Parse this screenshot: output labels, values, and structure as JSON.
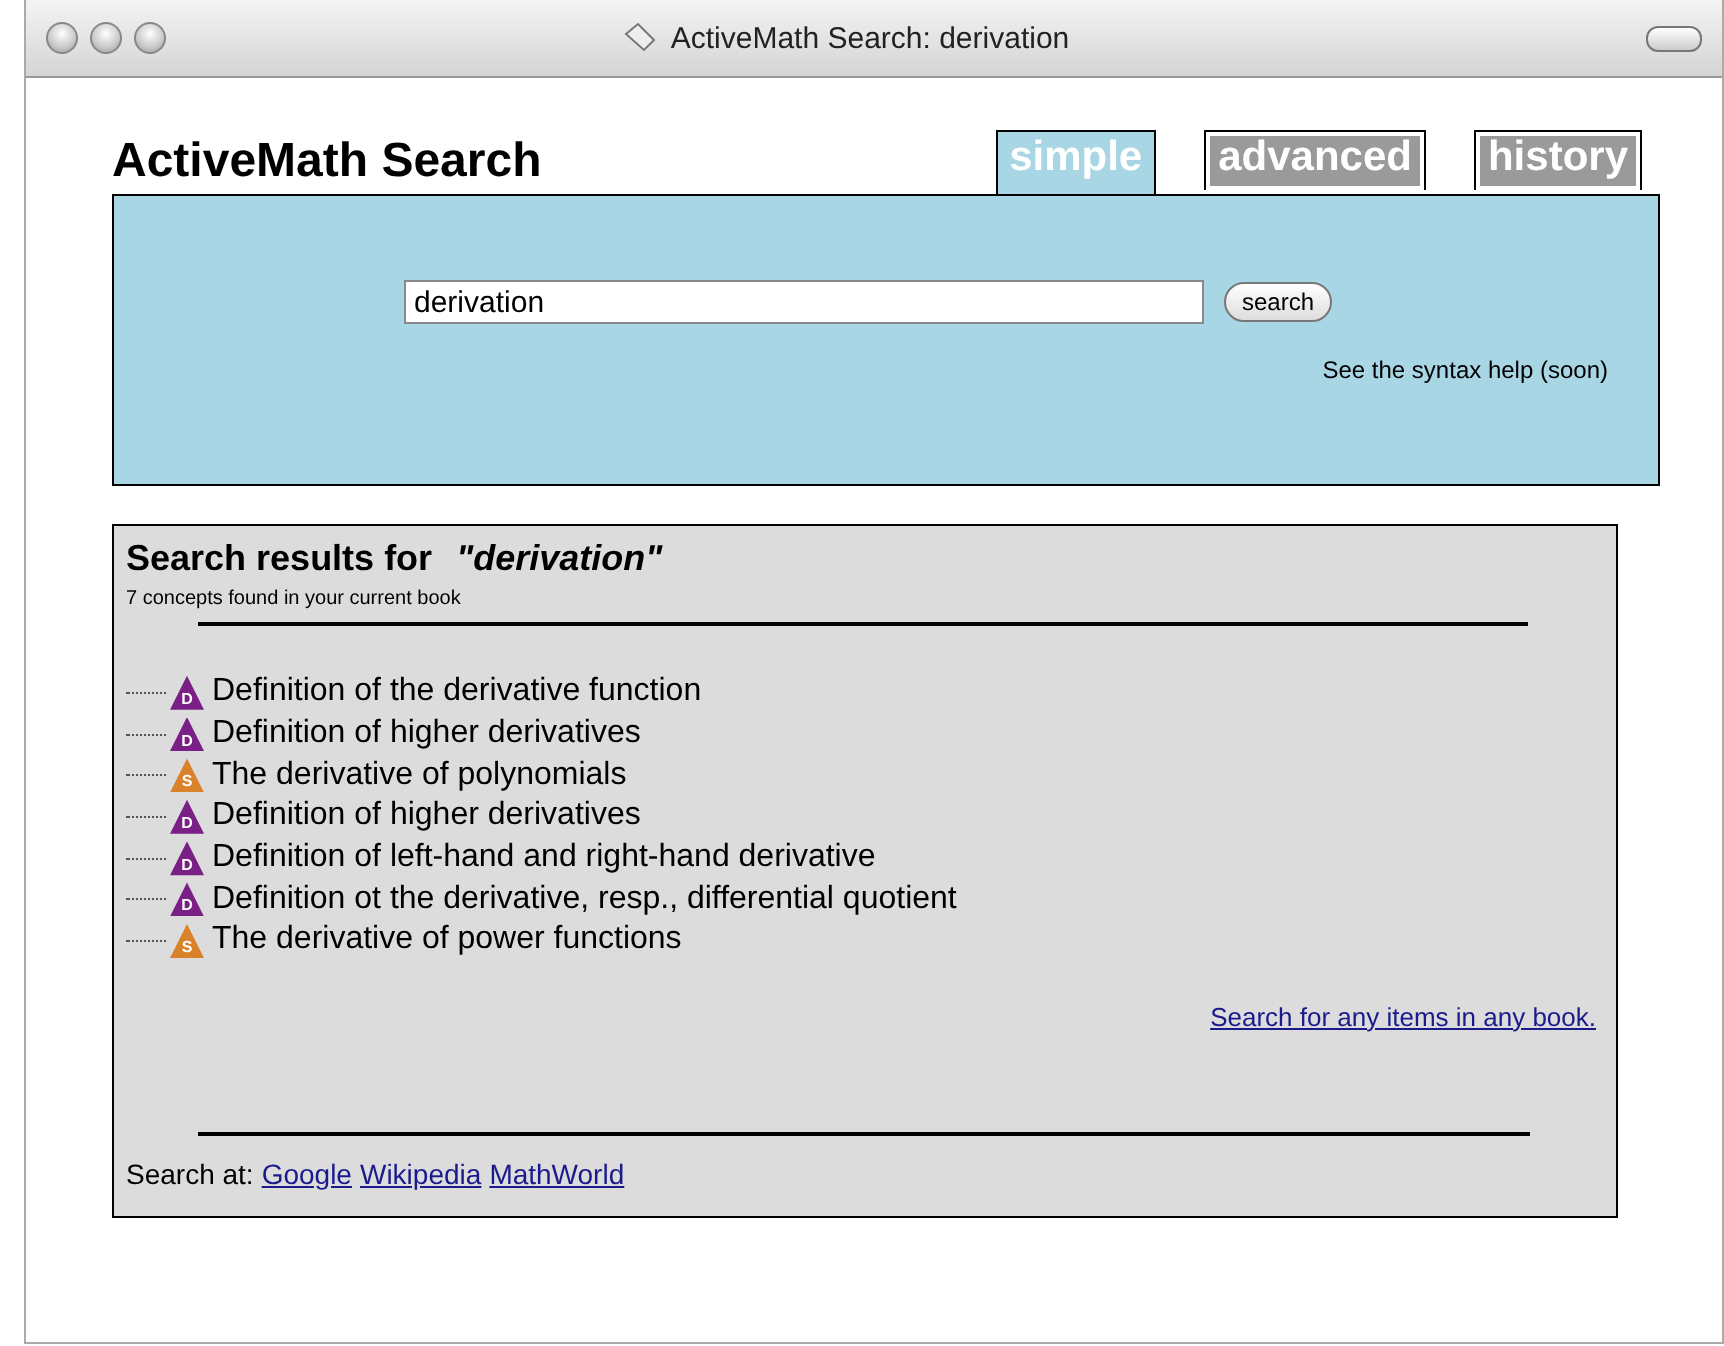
{
  "window": {
    "title": "ActiveMath Search: derivation"
  },
  "page": {
    "heading": "ActiveMath Search"
  },
  "tabs": [
    {
      "label": "simple",
      "selected": true
    },
    {
      "label": "advanced",
      "selected": false
    },
    {
      "label": "history",
      "selected": false
    }
  ],
  "search": {
    "value": "derivation",
    "button": "search",
    "help": "See the syntax help (soon)"
  },
  "results": {
    "title": "Search results for",
    "query": "\"derivation\"",
    "count": "7 concepts found in your current book",
    "items": [
      {
        "kind": "definition",
        "badge": "D",
        "label": "Definition of the derivative function"
      },
      {
        "kind": "definition",
        "badge": "D",
        "label": "Definition of higher derivatives"
      },
      {
        "kind": "theorem",
        "badge": "S",
        "label": "The derivative of polynomials"
      },
      {
        "kind": "definition",
        "badge": "D",
        "label": "Definition of higher derivatives"
      },
      {
        "kind": "definition",
        "badge": "D",
        "label": "Definition of left-hand and right-hand derivative"
      },
      {
        "kind": "definition",
        "badge": "D",
        "label": "Definition ot the derivative, resp., differential quotient"
      },
      {
        "kind": "theorem",
        "badge": "S",
        "label": "The derivative of power functions"
      }
    ],
    "any_link": "Search for any items in any book.",
    "search_at": "Search at:",
    "external_links": [
      "Google",
      "Wikipedia",
      "MathWorld"
    ]
  }
}
